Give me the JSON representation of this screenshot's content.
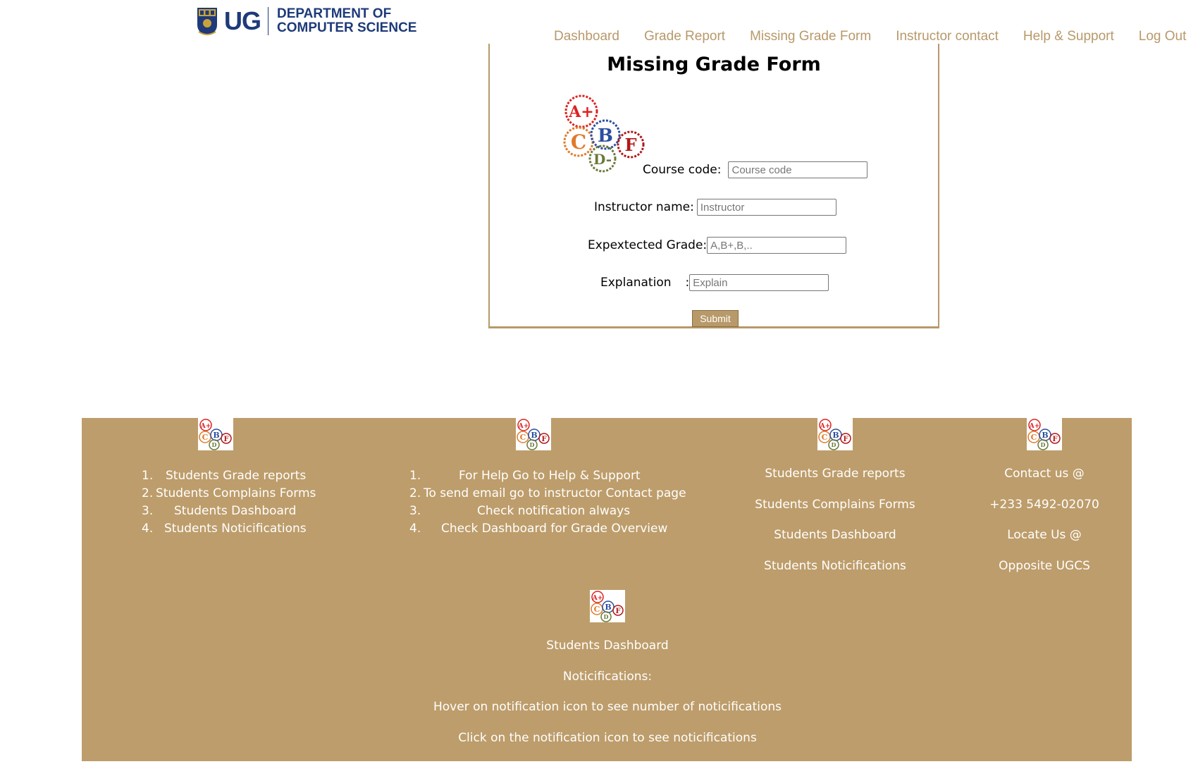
{
  "header": {
    "logo_text": "UG",
    "dept_line1": "DEPARTMENT OF",
    "dept_line2": "COMPUTER SCIENCE"
  },
  "nav": {
    "items": [
      "Dashboard",
      "Grade Report",
      "Missing Grade Form",
      "Instructor contact",
      "Help & Support",
      "Log Out"
    ]
  },
  "form": {
    "title": "Missing Grade Form",
    "course_label": "Course code:",
    "course_placeholder": "Course code",
    "instructor_label": "Instructor name:",
    "instructor_placeholder": "Instructor",
    "grade_label": "Expextected Grade:",
    "grade_placeholder": "A,B+,B,..",
    "explanation_label": "Explanation",
    "explanation_colon": ":",
    "explanation_placeholder": "Explain",
    "submit_label": "Submit"
  },
  "footer": {
    "col1": [
      {
        "num": "1.",
        "text": "Students Grade reports"
      },
      {
        "num": "2.",
        "text": "Students Complains Forms"
      },
      {
        "num": "3.",
        "text": "Students Dashboard"
      },
      {
        "num": "4.",
        "text": "Students Noticifications"
      }
    ],
    "col2": [
      {
        "num": "1.",
        "text": "For Help Go to Help & Support"
      },
      {
        "num": "2.",
        "text": "To send email go to instructor Contact page"
      },
      {
        "num": "3.",
        "text": "Check notification always"
      },
      {
        "num": "4.",
        "text": "Check Dashboard for Grade Overview"
      }
    ],
    "col3": [
      "Students Grade reports",
      "Students Complains Forms",
      "Students Dashboard",
      "Students Noticifications"
    ],
    "col4": [
      "Contact us @",
      "+233 5492-02070",
      "Locate Us @",
      "Opposite UGCS"
    ],
    "col5": [
      "Students Dashboard",
      "Noticifications:",
      "Hover on notification icon to see number of noticifications",
      "Click on the notification icon to see noticifications"
    ]
  },
  "colors": {
    "accent": "#b8996a",
    "footer_bg": "#bd9d6b",
    "brand_blue": "#1e3a78"
  }
}
